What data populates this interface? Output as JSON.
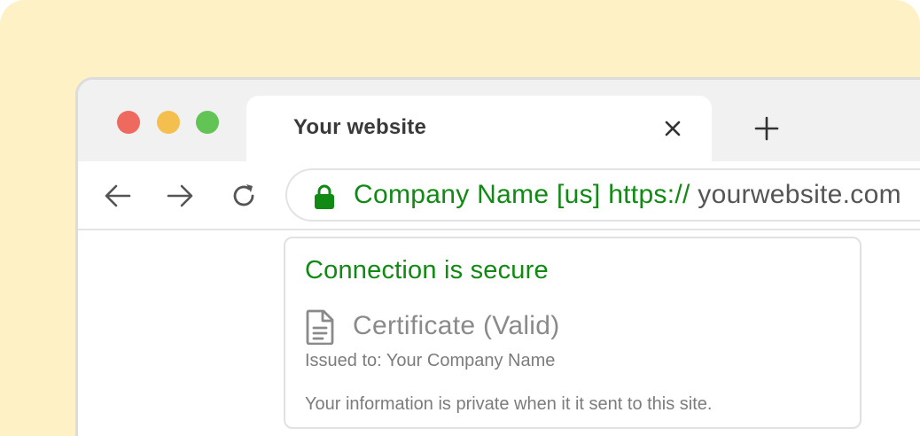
{
  "window": {
    "traffic_lights": [
      "close",
      "minimize",
      "maximize"
    ]
  },
  "tab": {
    "title": "Your website",
    "close_icon": "close-icon"
  },
  "new_tab": {
    "icon": "plus-icon"
  },
  "toolbar": {
    "back_icon": "arrow-left-icon",
    "forward_icon": "arrow-right-icon",
    "reload_icon": "reload-icon"
  },
  "address_bar": {
    "lock_icon": "lock-icon",
    "company": "Company Name [us]",
    "scheme": "https://",
    "host": "yourwebsite.com",
    "secure_color": "#108a13"
  },
  "security_popup": {
    "heading": "Connection is secure",
    "certificate_icon": "document-icon",
    "certificate_title": "Certificate (Valid)",
    "issued_to": "Issued to: Your Company Name",
    "privacy_note": "Your information is private when it it sent to this site."
  },
  "colors": {
    "background": "#fef1c6",
    "secure_green": "#108a13",
    "traffic_red": "#ee6a5e",
    "traffic_yellow": "#f5bf4f",
    "traffic_green": "#61c454"
  }
}
